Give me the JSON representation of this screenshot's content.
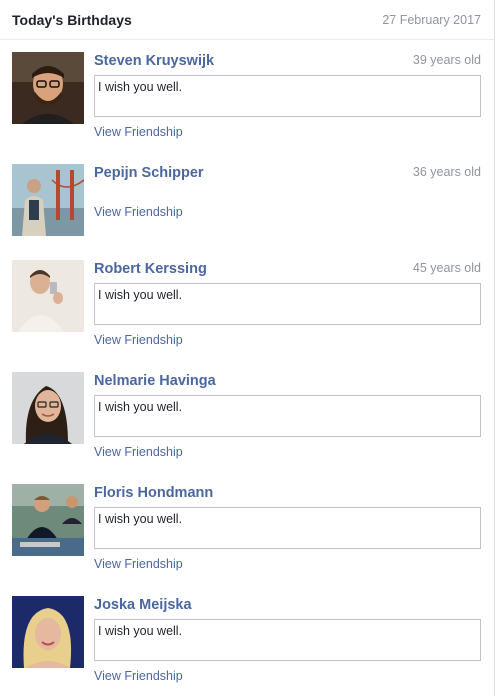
{
  "header": {
    "title": "Today's Birthdays",
    "date": "27 February 2017"
  },
  "people": [
    {
      "name": "Steven Kruyswijk",
      "age": "39 years old",
      "message": "I wish you well.",
      "link": "View Friendship"
    },
    {
      "name": "Pepijn Schipper",
      "age": "36 years old",
      "link": "View Friendship"
    },
    {
      "name": "Robert Kerssing",
      "age": "45 years old",
      "message": "I wish you well.",
      "link": "View Friendship"
    },
    {
      "name": "Nelmarie Havinga",
      "message": "I wish you well.",
      "link": "View Friendship"
    },
    {
      "name": "Floris Hondmann",
      "message": "I wish you well.",
      "link": "View Friendship"
    },
    {
      "name": "Joska Meijska",
      "message": "I wish you well.",
      "link": "View Friendship"
    }
  ]
}
